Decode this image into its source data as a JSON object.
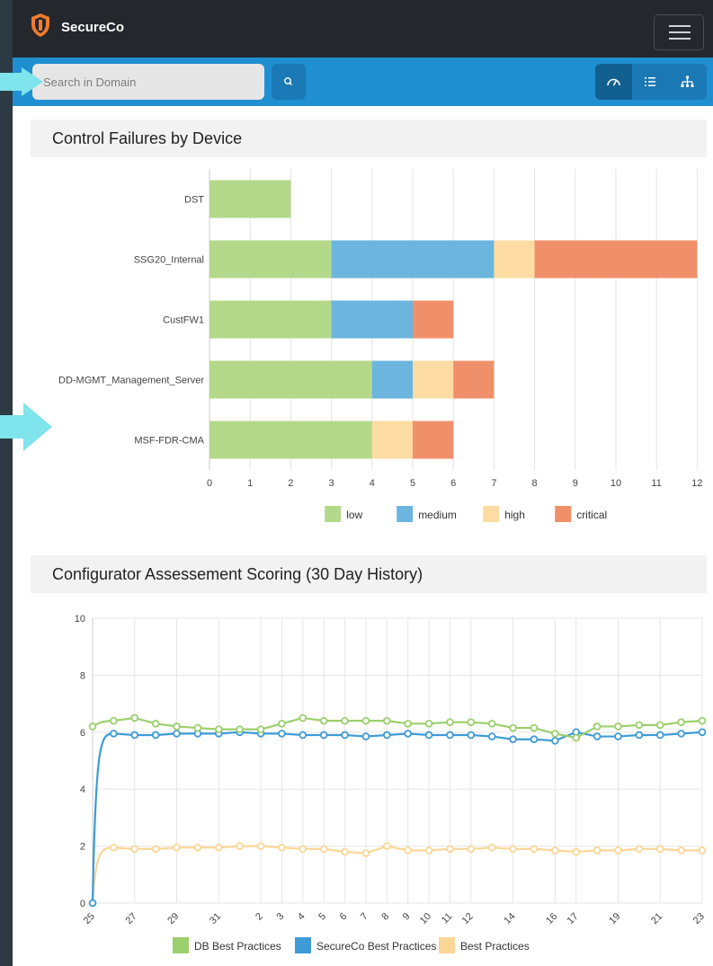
{
  "app": {
    "brand": "SecureCo",
    "colors": {
      "topbar": "#24272c",
      "toolbar": "#1f8fd1",
      "accent_dark": "#12608f",
      "logo": "#f07c2c"
    }
  },
  "header": {
    "logo_icon": "shield-icon",
    "menu_icon": "hamburger-icon"
  },
  "search": {
    "placeholder": "Search in Domain",
    "value": "",
    "button_icon": "search-icon"
  },
  "view_toggle": {
    "items": [
      {
        "icon": "dashboard-gauge-icon",
        "active": true
      },
      {
        "icon": "list-icon",
        "active": false
      },
      {
        "icon": "hierarchy-icon",
        "active": false
      }
    ]
  },
  "panels": {
    "failures": {
      "title": "Control Failures by Device"
    },
    "scoring": {
      "title": "Configurator Assessement Scoring (30 Day History)"
    }
  },
  "chart_data": [
    {
      "type": "bar",
      "orientation": "horizontal",
      "stacked": true,
      "title": "Control Failures by Device",
      "categories": [
        "DST",
        "SSG20_Internal",
        "CustFW1",
        "DD-MGMT_Management_Server",
        "MSF-FDR-CMA"
      ],
      "series": [
        {
          "name": "low",
          "color": "#b3d88a",
          "values": [
            2,
            3,
            3,
            4,
            4
          ]
        },
        {
          "name": "medium",
          "color": "#6bb5de",
          "values": [
            0,
            4,
            2,
            1,
            0
          ]
        },
        {
          "name": "high",
          "color": "#fddca3",
          "values": [
            0,
            1,
            0,
            1,
            1
          ]
        },
        {
          "name": "critical",
          "color": "#f0906a",
          "values": [
            0,
            4,
            1,
            1,
            1
          ]
        }
      ],
      "xlim": [
        0,
        12
      ],
      "xticks": [
        "0",
        "1",
        "2",
        "3",
        "4",
        "5",
        "6",
        "7",
        "8",
        "9",
        "10",
        "11",
        "12"
      ],
      "grid": true,
      "legend": "bottom"
    },
    {
      "type": "line",
      "title": "Configurator Assessement Scoring (30 Day History)",
      "ylim": [
        0,
        10
      ],
      "yticks": [
        "0",
        "2",
        "4",
        "6",
        "8",
        "10"
      ],
      "x_tick_labels": [
        "25",
        "",
        "27",
        "",
        "29",
        "",
        "31",
        "",
        "2",
        "3",
        "4",
        "5",
        "6",
        "7",
        "8",
        "9",
        "10",
        "11",
        "12",
        "",
        "14",
        "",
        "16",
        "17",
        "",
        "19",
        "",
        "21",
        "",
        "23"
      ],
      "series": [
        {
          "name": "DB Best Practices",
          "color": "#9bcf6b",
          "values": [
            6.2,
            6.4,
            6.5,
            6.3,
            6.2,
            6.15,
            6.1,
            6.1,
            6.1,
            6.3,
            6.5,
            6.4,
            6.4,
            6.4,
            6.4,
            6.3,
            6.3,
            6.35,
            6.35,
            6.3,
            6.15,
            6.15,
            5.95,
            5.8,
            6.2,
            6.2,
            6.25,
            6.25,
            6.35,
            6.4
          ]
        },
        {
          "name": "SecureCo Best Practices",
          "color": "#3d9bd6",
          "values": [
            0,
            5.95,
            5.9,
            5.9,
            5.95,
            5.95,
            5.95,
            6.0,
            5.95,
            5.95,
            5.9,
            5.9,
            5.9,
            5.85,
            5.9,
            5.95,
            5.9,
            5.9,
            5.9,
            5.85,
            5.75,
            5.75,
            5.7,
            6.0,
            5.85,
            5.85,
            5.9,
            5.9,
            5.95,
            6.0
          ]
        },
        {
          "name": "Best Practices",
          "color": "#fbd695",
          "values": [
            0,
            1.95,
            1.9,
            1.9,
            1.95,
            1.95,
            1.95,
            2.0,
            2.0,
            1.95,
            1.9,
            1.9,
            1.8,
            1.75,
            2.0,
            1.85,
            1.85,
            1.9,
            1.9,
            1.95,
            1.9,
            1.9,
            1.85,
            1.8,
            1.85,
            1.85,
            1.9,
            1.9,
            1.85,
            1.85
          ]
        }
      ],
      "grid": true,
      "legend": "bottom"
    }
  ]
}
